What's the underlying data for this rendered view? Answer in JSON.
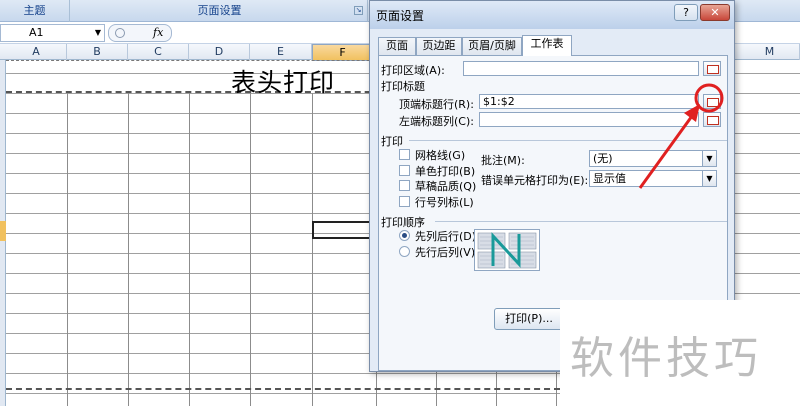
{
  "ribbon": {
    "group_theme": "主题",
    "group_page_setup": "页面设置",
    "launcher": "⊡"
  },
  "formula_bar": {
    "name_box": "A1",
    "fx": "fx"
  },
  "columns": [
    "A",
    "B",
    "C",
    "D",
    "E",
    "F",
    "M"
  ],
  "sheet": {
    "title_text": "表头打印"
  },
  "dialog": {
    "title": "页面设置",
    "help": "?",
    "close": "✕",
    "tabs": [
      "页面",
      "页边距",
      "页眉/页脚",
      "工作表"
    ],
    "print_area_label": "打印区域(A):",
    "print_titles_heading": "打印标题",
    "top_rows_label": "顶端标题行(R):",
    "top_rows_value": "$1:$2",
    "left_cols_label": "左端标题列(C):",
    "left_cols_value": "",
    "print_heading": "打印",
    "checkboxes": [
      "网格线(G)",
      "单色打印(B)",
      "草稿品质(Q)",
      "行号列标(L)"
    ],
    "comments_label": "批注(M):",
    "comments_value": "(无)",
    "errors_label": "错误单元格打印为(E):",
    "errors_value": "显示值",
    "order_heading": "打印顺序",
    "order_options": [
      "先列后行(D)",
      "先行后列(V)"
    ],
    "print_button": "打印(P)..."
  },
  "watermark": "软件技巧",
  "colors": {
    "accent_red": "#e02020",
    "header_blue": "#15428b"
  }
}
